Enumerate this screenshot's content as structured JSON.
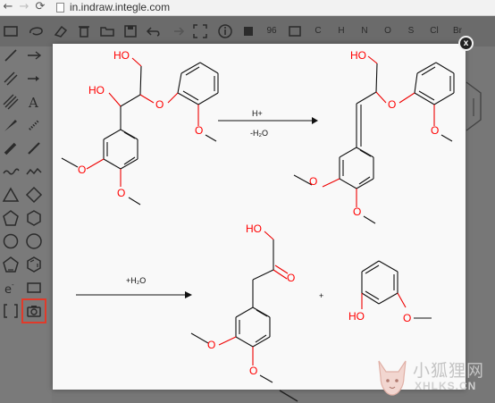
{
  "browser": {
    "back_icon": "arrow-left",
    "forward_icon": "arrow-right",
    "reload_icon": "reload",
    "url": "in.indraw.integle.com"
  },
  "toolbar": {
    "zoom_value": "96",
    "elements": [
      "C",
      "H",
      "N",
      "O",
      "S",
      "Cl",
      "Br"
    ]
  },
  "modal": {
    "close_label": "x",
    "reaction1": {
      "condition_top": "H+",
      "condition_bottom": "-H₂O"
    },
    "reaction2": {
      "condition_top": "+H₂O",
      "plus_sign": "+"
    },
    "atoms": {
      "ho": "HO",
      "o": "O"
    }
  },
  "watermark": {
    "cn": "小狐狸网",
    "en": "XHLKS.CN"
  },
  "colors": {
    "heteroatom": "#ff0000",
    "selected_tool_outline": "#e13a2a"
  }
}
